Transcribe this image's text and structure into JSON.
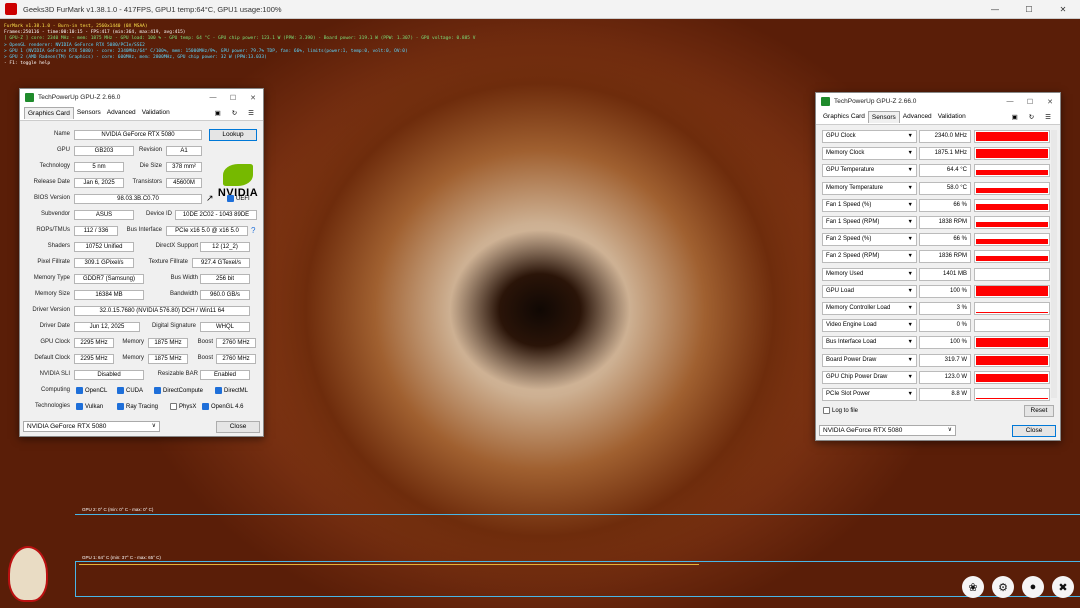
{
  "app": {
    "title": "Geeks3D FurMark v1.38.1.0 - 417FPS, GPU1 temp:64°C, GPU1 usage:100%"
  },
  "overlay": {
    "lines": [
      {
        "c": "y",
        "t": "FurMark v1.38.1.0 - Burn-in test, 2560x1440 (0X MSAA)"
      },
      {
        "c": "w",
        "t": "Frames:250116 - time:00:10:15 - FPS:417 (min:364, max:419, avg:415)"
      },
      {
        "c": "g",
        "t": "[ GPU-Z ] core: 2340 MHz - mem: 1875 MHz - GPU load: 100 % - GPU temp: 64 °C - GPU chip power: 123.1 W (PPW: 3.390) - Board power: 319.1 W (PPW: 1.307) - GPU voltage: 0.885 V"
      },
      {
        "c": "c",
        "t": "> OpenGL renderer: NVIDIA GeForce RTX 5080/PCIe/SSE2"
      },
      {
        "c": "c",
        "t": "> GPU 1 (NVIDIA GeForce RTX 5080) - core: 2340MHz/64° C/100%, mem: 15000MHz/9%, GPU power: 79.7% TDP, fan: 66%, limits(power:1, temp:0, volt:0, OV:0)"
      },
      {
        "c": "c",
        "t": "> GPU 2 (AMD Radeon(TM) Graphics) - core: 600MHz, mem: 2800MHz, GPU chip power: 32 W (PPW:13.033)"
      },
      {
        "c": "w",
        "t": "- F1: toggle help"
      }
    ]
  },
  "gpuz1": {
    "title": "TechPowerUp GPU-Z 2.66.0",
    "tabs": [
      "Graphics Card",
      "Sensors",
      "Advanced",
      "Validation"
    ],
    "lookup": "Lookup",
    "nvidia": "NVIDIA",
    "name": {
      "l": "Name",
      "v": "NVIDIA GeForce RTX 5080"
    },
    "gpu": {
      "l": "GPU",
      "v": "GB203"
    },
    "revision": {
      "l": "Revision",
      "v": "A1"
    },
    "technology": {
      "l": "Technology",
      "v": "5 nm"
    },
    "diesize": {
      "l": "Die Size",
      "v": "378 mm²"
    },
    "release": {
      "l": "Release Date",
      "v": "Jan 6, 2025"
    },
    "transistors": {
      "l": "Transistors",
      "v": "45600M"
    },
    "bios": {
      "l": "BIOS Version",
      "v": "98.03.3B.C0.70"
    },
    "uefi": "UEFI",
    "subvendor": {
      "l": "Subvendor",
      "v": "ASUS"
    },
    "deviceid": {
      "l": "Device ID",
      "v": "10DE 2C02 - 1043 89DE"
    },
    "rops": {
      "l": "ROPs/TMUs",
      "v": "112 / 336"
    },
    "busif": {
      "l": "Bus Interface",
      "v": "PCIe x16 5.0 @ x16 5.0"
    },
    "question": "?",
    "shaders": {
      "l": "Shaders",
      "v": "10752 Unified"
    },
    "dx": {
      "l": "DirectX Support",
      "v": "12 (12_2)"
    },
    "pixel": {
      "l": "Pixel Fillrate",
      "v": "309.1 GPixel/s"
    },
    "texture": {
      "l": "Texture Fillrate",
      "v": "927.4 GTexel/s"
    },
    "memtype": {
      "l": "Memory Type",
      "v": "GDDR7 (Samsung)"
    },
    "buswidth": {
      "l": "Bus Width",
      "v": "256 bit"
    },
    "memsize": {
      "l": "Memory Size",
      "v": "16384 MB"
    },
    "bandwidth": {
      "l": "Bandwidth",
      "v": "960.0 GB/s"
    },
    "driver": {
      "l": "Driver Version",
      "v": "32.0.15.7680 (NVIDIA 576.80) DCH / Win11 64"
    },
    "driverdate": {
      "l": "Driver Date",
      "v": "Jun 12, 2025"
    },
    "digsig": {
      "l": "Digital Signature",
      "v": "WHQL"
    },
    "gpuclock": {
      "l": "GPU Clock",
      "v": "2295 MHz"
    },
    "memory": {
      "l": "Memory",
      "v": "1875 MHz"
    },
    "boost": {
      "l": "Boost",
      "v": "2760 MHz"
    },
    "defclock": {
      "l": "Default Clock",
      "v": "2295 MHz"
    },
    "memory2": {
      "l": "Memory",
      "v": "1875 MHz"
    },
    "boost2": {
      "l": "Boost",
      "v": "2760 MHz"
    },
    "sli": {
      "l": "NVIDIA SLI",
      "v": "Disabled"
    },
    "rebar": {
      "l": "Resizable BAR",
      "v": "Enabled"
    },
    "computing": {
      "l": "Computing",
      "items": [
        "OpenCL",
        "CUDA",
        "DirectCompute",
        "DirectML"
      ]
    },
    "technologies": {
      "l": "Technologies",
      "items": [
        "Vulkan",
        "Ray Tracing",
        "PhysX",
        "OpenGL 4.6"
      ]
    },
    "select": "NVIDIA GeForce RTX 5080",
    "close": "Close"
  },
  "gpuz2": {
    "title": "TechPowerUp GPU-Z 2.66.0",
    "tabs": [
      "Graphics Card",
      "Sensors",
      "Advanced",
      "Validation"
    ],
    "sensors": [
      {
        "n": "GPU Clock",
        "v": "2340.0 MHz",
        "f": 0.82
      },
      {
        "n": "Memory Clock",
        "v": "1875.1 MHz",
        "f": 0.82
      },
      {
        "n": "GPU Temperature",
        "v": "64.4 °C",
        "f": 0.5
      },
      {
        "n": "Memory Temperature",
        "v": "58.0 °C",
        "f": 0.45
      },
      {
        "n": "Fan 1 Speed (%)",
        "v": "66 %",
        "f": 0.5
      },
      {
        "n": "Fan 1 Speed (RPM)",
        "v": "1838 RPM",
        "f": 0.5
      },
      {
        "n": "Fan 2 Speed (%)",
        "v": "66 %",
        "f": 0.5
      },
      {
        "n": "Fan 2 Speed (RPM)",
        "v": "1836 RPM",
        "f": 0.5
      },
      {
        "n": "Memory Used",
        "v": "1401 MB",
        "f": 0.0
      },
      {
        "n": "GPU Load",
        "v": "100 %",
        "f": 0.9
      },
      {
        "n": "Memory Controller Load",
        "v": "3 %",
        "f": 0.05
      },
      {
        "n": "Video Engine Load",
        "v": "0 %",
        "f": 0.0
      },
      {
        "n": "Bus Interface Load",
        "v": "100 %",
        "f": 0.9
      },
      {
        "n": "Board Power Draw",
        "v": "319.7 W",
        "f": 0.75
      },
      {
        "n": "GPU Chip Power Draw",
        "v": "123.0 W",
        "f": 0.75
      },
      {
        "n": "PCIe Slot Power",
        "v": "8.8 W",
        "f": 0.05
      }
    ],
    "log": "Log to file",
    "reset": "Reset",
    "select": "NVIDIA GeForce RTX 5080",
    "close": "Close"
  },
  "graphs": {
    "gpu2": "GPU 2: 0° C (min: 0° C - max: 0° C)",
    "gpu1": "GPU 1: 64° C (min: 37° C - max: 65° C)"
  }
}
